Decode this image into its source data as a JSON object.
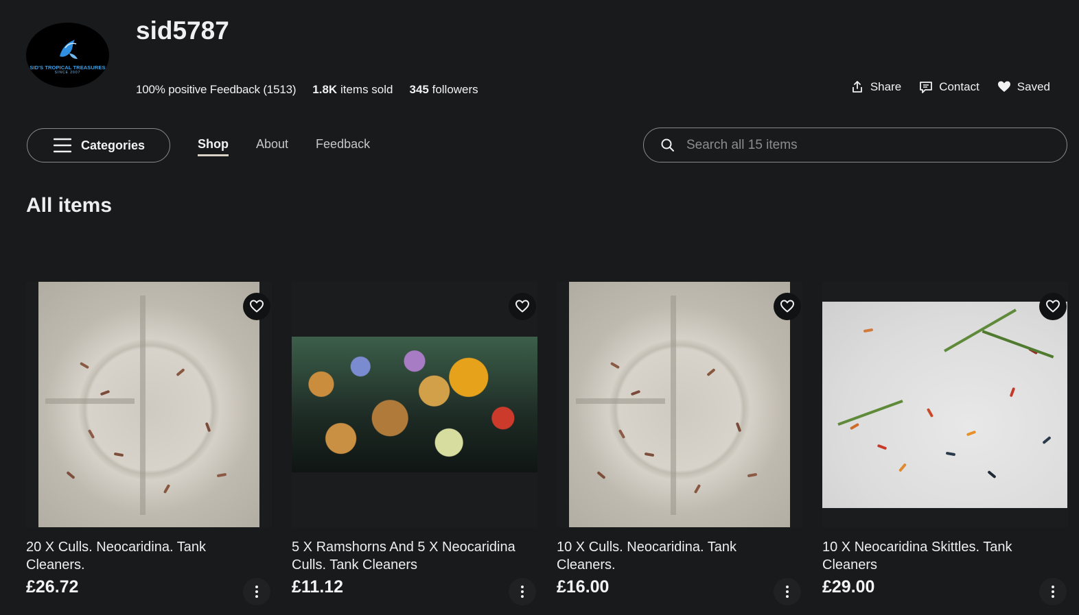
{
  "seller": {
    "logo_text": "SID'S TROPICAL TREASURES",
    "logo_subtext": "SINCE 2007",
    "name": "sid5787",
    "feedback": "100% positive Feedback (1513)",
    "sold_count": "1.8K",
    "sold_label": "items sold",
    "followers_count": "345",
    "followers_label": "followers"
  },
  "actions": {
    "share": "Share",
    "contact": "Contact",
    "saved": "Saved"
  },
  "nav": {
    "categories": "Categories",
    "tabs": [
      "Shop",
      "About",
      "Feedback"
    ],
    "active_tab": "Shop"
  },
  "search": {
    "placeholder": "Search all 15 items"
  },
  "section_title": "All items",
  "items": [
    {
      "title": "20 X Culls. Neocaridina. Tank Cleaners.",
      "price": "£26.72"
    },
    {
      "title": "5 X Ramshorns And 5 X Neocaridina Culls. Tank Cleaners",
      "price": "£11.12"
    },
    {
      "title": "10 X Culls. Neocaridina. Tank Cleaners.",
      "price": "£16.00"
    },
    {
      "title": "10 X Neocaridina Skittles. Tank Cleaners",
      "price": "£29.00"
    }
  ],
  "colors": {
    "background": "#191a1c",
    "text": "#f2f2f2",
    "muted": "#8d8d8d"
  }
}
